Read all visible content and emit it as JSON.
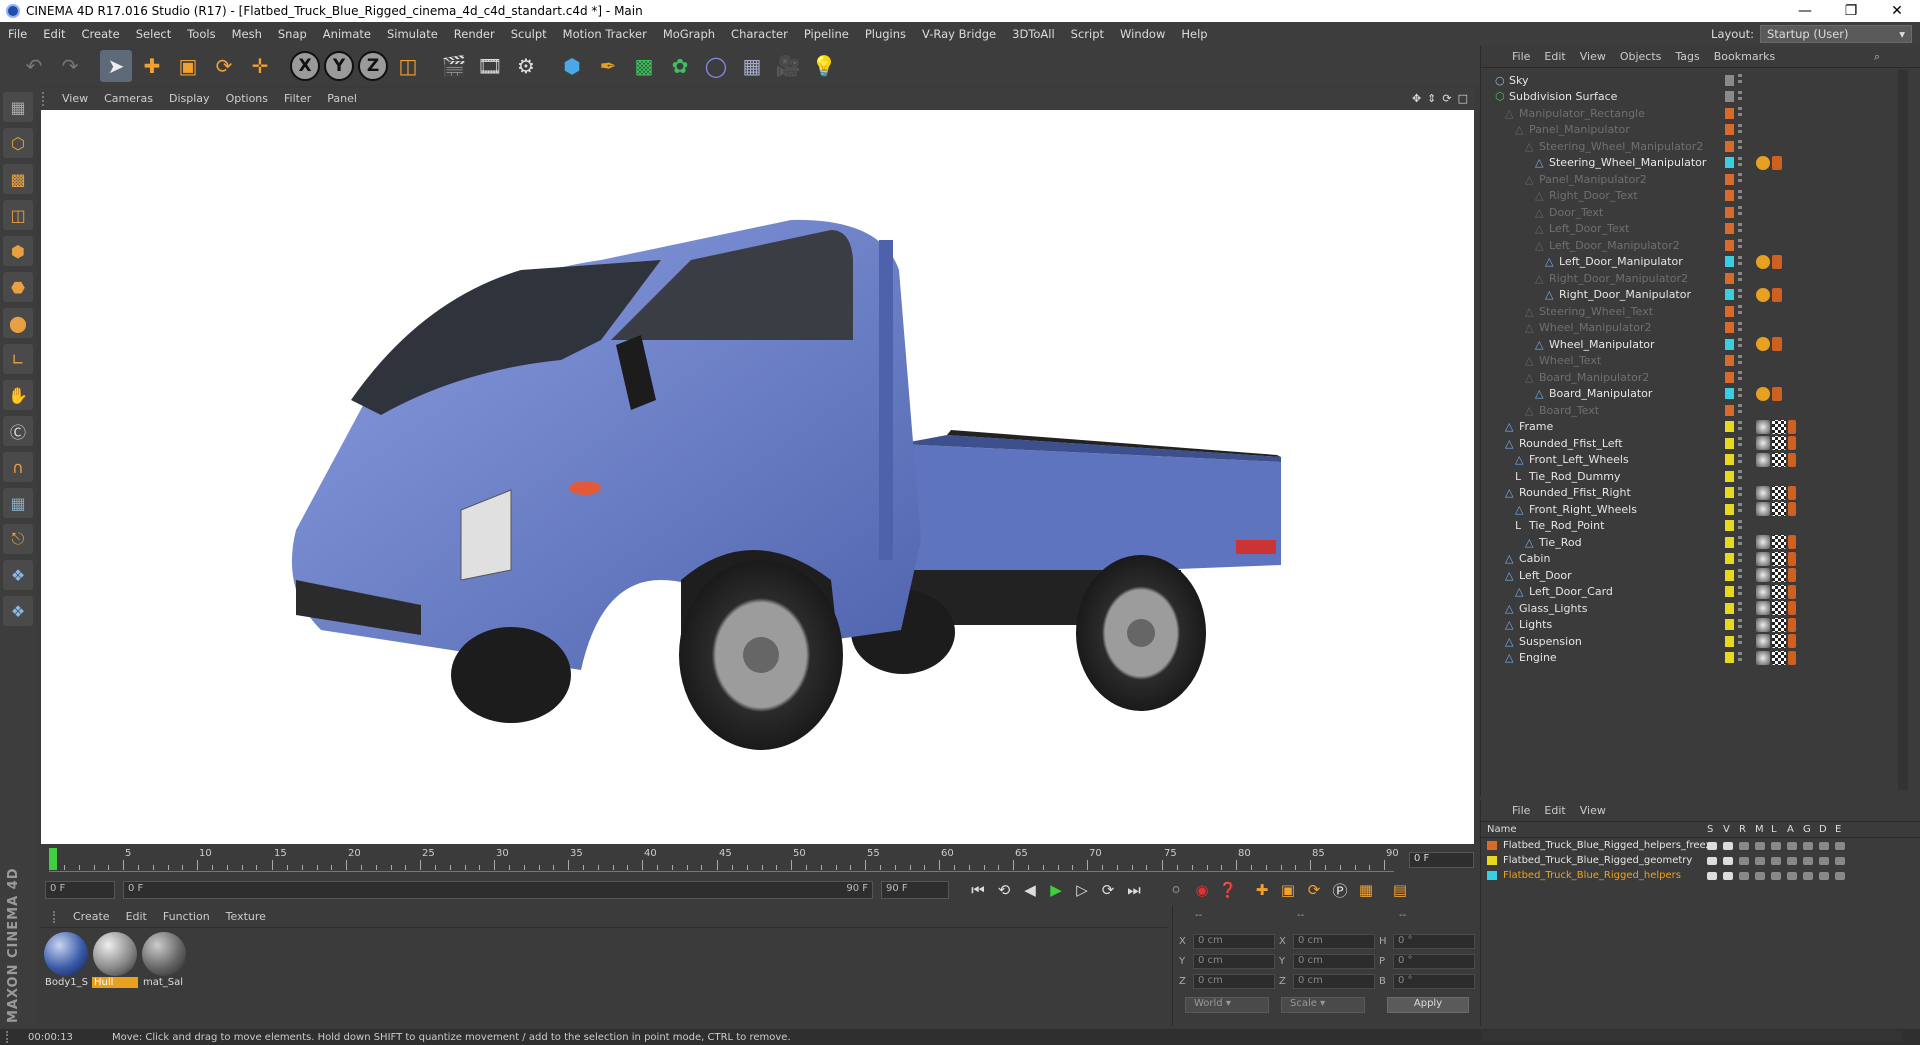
{
  "window": {
    "title": "CINEMA 4D R17.016 Studio (R17) - [Flatbed_Truck_Blue_Rigged_cinema_4d_c4d_standart.c4d *] - Main"
  },
  "menubar": {
    "items": [
      "File",
      "Edit",
      "Create",
      "Select",
      "Tools",
      "Mesh",
      "Snap",
      "Animate",
      "Simulate",
      "Render",
      "Sculpt",
      "Motion Tracker",
      "MoGraph",
      "Character",
      "Pipeline",
      "Plugins",
      "V-Ray Bridge",
      "3DToAll",
      "Script",
      "Window",
      "Help"
    ],
    "layout_label": "Layout:",
    "layout_value": "Startup (User)"
  },
  "toolbar": {
    "axis_x": "X",
    "axis_y": "Y",
    "axis_z": "Z"
  },
  "viewport": {
    "menu": [
      "View",
      "Cameras",
      "Display",
      "Options",
      "Filter",
      "Panel"
    ]
  },
  "timeline": {
    "ticks": [
      "0",
      "5",
      "10",
      "15",
      "20",
      "25",
      "30",
      "35",
      "40",
      "45",
      "50",
      "55",
      "60",
      "65",
      "70",
      "75",
      "80",
      "85",
      "90"
    ],
    "current_frame": "0 F",
    "start_frame": "0 F",
    "range_start": "0 F",
    "range_end": "90 F",
    "end_frame": "90 F"
  },
  "material_manager": {
    "menu": [
      "Create",
      "Edit",
      "Function",
      "Texture"
    ],
    "materials": [
      {
        "name": "Body1_S",
        "selected": false
      },
      {
        "name": "Hull",
        "selected": true
      },
      {
        "name": "mat_Sal",
        "selected": false
      }
    ]
  },
  "coordinates": {
    "headers": [
      "--",
      "--",
      "--"
    ],
    "rows": [
      {
        "a": "X",
        "av": "0 cm",
        "b": "X",
        "bv": "0 cm",
        "c": "H",
        "cv": "0 °"
      },
      {
        "a": "Y",
        "av": "0 cm",
        "b": "Y",
        "bv": "0 cm",
        "c": "P",
        "cv": "0 °"
      },
      {
        "a": "Z",
        "av": "0 cm",
        "b": "Z",
        "bv": "0 cm",
        "c": "B",
        "cv": "0 °"
      }
    ],
    "world": "World",
    "scale": "Scale",
    "apply": "Apply"
  },
  "status": {
    "time": "00:00:13",
    "message": "Move: Click and drag to move elements. Hold down SHIFT to quantize movement / add to the selection in point mode, CTRL to remove."
  },
  "logo": {
    "text": "MAXON CINEMA 4D"
  },
  "object_manager": {
    "menu": [
      "File",
      "Edit",
      "View",
      "Objects",
      "Tags",
      "Bookmarks"
    ],
    "objects": [
      {
        "name": "Sky",
        "indent": 0,
        "dim": false,
        "color": "#8a8a8a",
        "icon": "sky-icon"
      },
      {
        "name": "Subdivision Surface",
        "indent": 0,
        "dim": false,
        "color": "#8a8a8a",
        "icon": "subdivision-icon"
      },
      {
        "name": "Manipulator_Rectangle",
        "indent": 1,
        "dim": true,
        "color": "#d86a2a",
        "icon": "null-icon"
      },
      {
        "name": "Panel_Manipulator",
        "indent": 2,
        "dim": true,
        "color": "#d86a2a",
        "icon": "null-icon"
      },
      {
        "name": "Steering_Wheel_Manipulator2",
        "indent": 3,
        "dim": true,
        "color": "#d86a2a",
        "icon": "null-icon"
      },
      {
        "name": "Steering_Wheel_Manipulator",
        "indent": 4,
        "dim": false,
        "color": "#38d0e0",
        "icon": "joint-icon"
      },
      {
        "name": "Panel_Manipulator2",
        "indent": 3,
        "dim": true,
        "color": "#d86a2a",
        "icon": "null-icon"
      },
      {
        "name": "Right_Door_Text",
        "indent": 4,
        "dim": true,
        "color": "#d86a2a",
        "icon": "null-icon"
      },
      {
        "name": "Door_Text",
        "indent": 4,
        "dim": true,
        "color": "#d86a2a",
        "icon": "null-icon"
      },
      {
        "name": "Left_Door_Text",
        "indent": 4,
        "dim": true,
        "color": "#d86a2a",
        "icon": "null-icon"
      },
      {
        "name": "Left_Door_Manipulator2",
        "indent": 4,
        "dim": true,
        "color": "#d86a2a",
        "icon": "null-icon"
      },
      {
        "name": "Left_Door_Manipulator",
        "indent": 5,
        "dim": false,
        "color": "#38d0e0",
        "icon": "joint-icon"
      },
      {
        "name": "Right_Door_Manipulator2",
        "indent": 4,
        "dim": true,
        "color": "#d86a2a",
        "icon": "null-icon"
      },
      {
        "name": "Right_Door_Manipulator",
        "indent": 5,
        "dim": false,
        "color": "#38d0e0",
        "icon": "joint-icon"
      },
      {
        "name": "Steering_Wheel_Text",
        "indent": 3,
        "dim": true,
        "color": "#d86a2a",
        "icon": "null-icon"
      },
      {
        "name": "Wheel_Manipulator2",
        "indent": 3,
        "dim": true,
        "color": "#d86a2a",
        "icon": "null-icon"
      },
      {
        "name": "Wheel_Manipulator",
        "indent": 4,
        "dim": false,
        "color": "#38d0e0",
        "icon": "joint-icon"
      },
      {
        "name": "Wheel_Text",
        "indent": 3,
        "dim": true,
        "color": "#d86a2a",
        "icon": "null-icon"
      },
      {
        "name": "Board_Manipulator2",
        "indent": 3,
        "dim": true,
        "color": "#d86a2a",
        "icon": "null-icon"
      },
      {
        "name": "Board_Manipulator",
        "indent": 4,
        "dim": false,
        "color": "#38d0e0",
        "icon": "joint-icon"
      },
      {
        "name": "Board_Text",
        "indent": 3,
        "dim": true,
        "color": "#d86a2a",
        "icon": "null-icon"
      },
      {
        "name": "Frame",
        "indent": 1,
        "dim": false,
        "color": "#e8d820",
        "icon": "polygon-icon"
      },
      {
        "name": "Rounded_Ffist_Left",
        "indent": 1,
        "dim": false,
        "color": "#e8d820",
        "icon": "polygon-icon"
      },
      {
        "name": "Front_Left_Wheels",
        "indent": 2,
        "dim": false,
        "color": "#e8d820",
        "icon": "polygon-icon"
      },
      {
        "name": "Tie_Rod_Dummy",
        "indent": 2,
        "dim": false,
        "color": "#e8d820",
        "icon": "null-object-icon"
      },
      {
        "name": "Rounded_Ffist_Right",
        "indent": 1,
        "dim": false,
        "color": "#e8d820",
        "icon": "polygon-icon"
      },
      {
        "name": "Front_Right_Wheels",
        "indent": 2,
        "dim": false,
        "color": "#e8d820",
        "icon": "polygon-icon"
      },
      {
        "name": "Tie_Rod_Point",
        "indent": 2,
        "dim": false,
        "color": "#e8d820",
        "icon": "null-object-icon"
      },
      {
        "name": "Tie_Rod",
        "indent": 3,
        "dim": false,
        "color": "#e8d820",
        "icon": "polygon-icon"
      },
      {
        "name": "Cabin",
        "indent": 1,
        "dim": false,
        "color": "#e8d820",
        "icon": "polygon-icon"
      },
      {
        "name": "Left_Door",
        "indent": 1,
        "dim": false,
        "color": "#e8d820",
        "icon": "polygon-icon"
      },
      {
        "name": "Left_Door_Card",
        "indent": 2,
        "dim": false,
        "color": "#e8d820",
        "icon": "polygon-icon"
      },
      {
        "name": "Glass_Lights",
        "indent": 1,
        "dim": false,
        "color": "#e8d820",
        "icon": "polygon-icon"
      },
      {
        "name": "Lights",
        "indent": 1,
        "dim": false,
        "color": "#e8d820",
        "icon": "polygon-icon"
      },
      {
        "name": "Suspension",
        "indent": 1,
        "dim": false,
        "color": "#e8d820",
        "icon": "polygon-icon"
      },
      {
        "name": "Engine",
        "indent": 1,
        "dim": false,
        "color": "#e8d820",
        "icon": "polygon-icon"
      }
    ]
  },
  "layer_manager": {
    "menu": [
      "File",
      "Edit",
      "View"
    ],
    "columns": [
      "Name",
      "S",
      "V",
      "R",
      "M",
      "L",
      "A",
      "G",
      "D",
      "E"
    ],
    "layers": [
      {
        "name": "Flatbed_Truck_Blue_Rigged_helpers_freez",
        "color": "#d86a2a",
        "active": false
      },
      {
        "name": "Flatbed_Truck_Blue_Rigged_geometry",
        "color": "#e8d820",
        "active": false
      },
      {
        "name": "Flatbed_Truck_Blue_Rigged_helpers",
        "color": "#38d0e0",
        "active": true
      }
    ]
  }
}
